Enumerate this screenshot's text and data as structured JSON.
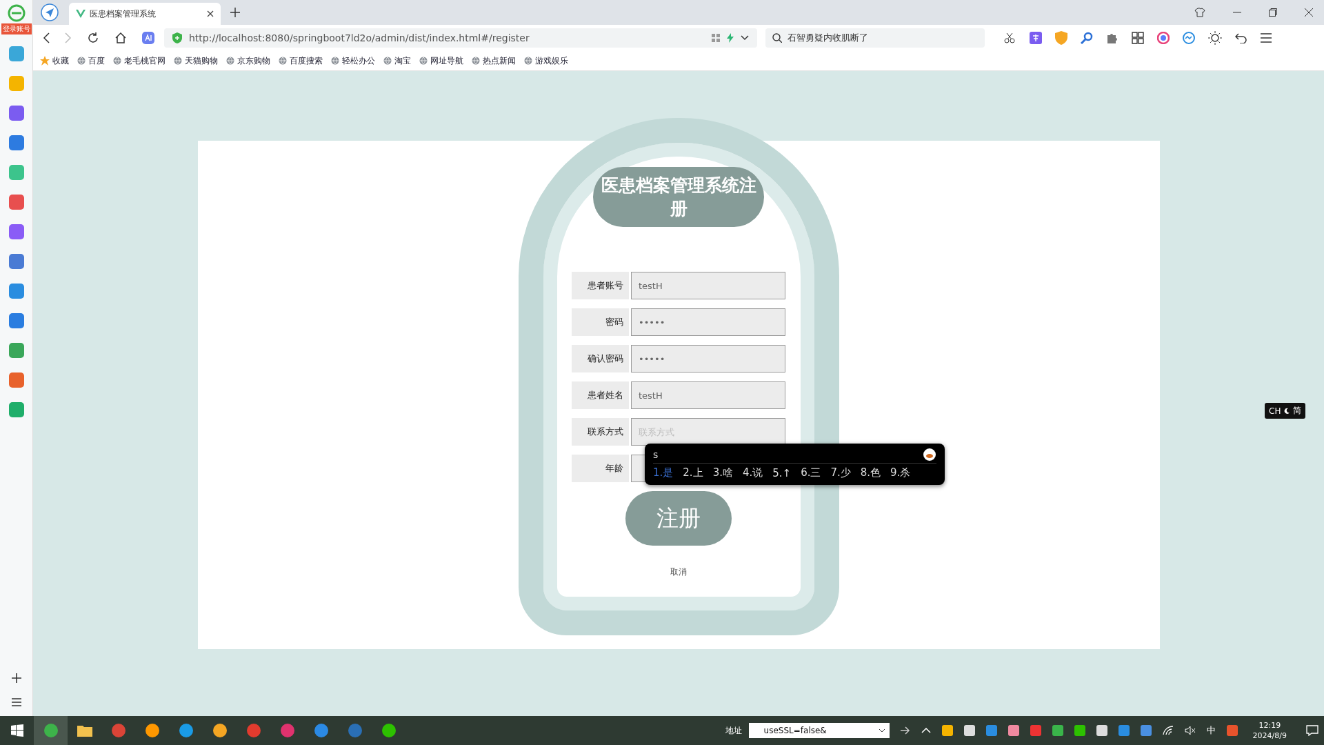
{
  "sidebar": {
    "badge": "登录账号"
  },
  "browser": {
    "tab_title": "医患档案管理系统",
    "url": "http://localhost:8080/springboot7ld2o/admin/dist/index.html#/register",
    "search": "石智勇疑内收肌断了",
    "bookmarks": [
      {
        "label": "收藏"
      },
      {
        "label": "百度"
      },
      {
        "label": "老毛桃官网"
      },
      {
        "label": "天猫购物"
      },
      {
        "label": "京东购物"
      },
      {
        "label": "百度搜索"
      },
      {
        "label": "轻松办公"
      },
      {
        "label": "淘宝"
      },
      {
        "label": "网址导航"
      },
      {
        "label": "热点新闻"
      },
      {
        "label": "游戏娱乐"
      }
    ]
  },
  "form": {
    "title": "医患档案管理系统注册",
    "fields": [
      {
        "label": "患者账号",
        "value": "testH"
      },
      {
        "label": "密码",
        "value": "•••••"
      },
      {
        "label": "确认密码",
        "value": "•••••"
      },
      {
        "label": "患者姓名",
        "value": "testH"
      },
      {
        "label": "联系方式",
        "placeholder": "联系方式"
      },
      {
        "label": "年龄"
      }
    ],
    "submit": "注册",
    "cancel": "取消"
  },
  "ime": {
    "input": "s",
    "candidates": [
      {
        "label": "1.是",
        "selected": true
      },
      {
        "label": "2.上",
        "selected": false
      },
      {
        "label": "3.啥",
        "selected": false
      },
      {
        "label": "4.说",
        "selected": false
      },
      {
        "label": "5.↑",
        "selected": false
      },
      {
        "label": "6.三",
        "selected": false
      },
      {
        "label": "7.少",
        "selected": false
      },
      {
        "label": "8.色",
        "selected": false
      },
      {
        "label": "9.杀",
        "selected": false
      }
    ]
  },
  "language_bar": {
    "left": "CH",
    "right": "简"
  },
  "taskbar": {
    "apps": [
      {
        "kind": "start",
        "selected": false
      },
      {
        "kind": "browser",
        "selected": true
      },
      {
        "kind": "folder",
        "selected": false
      },
      {
        "kind": "chrome",
        "selected": false
      },
      {
        "kind": "sublime",
        "selected": false
      },
      {
        "kind": "edge",
        "selected": false
      },
      {
        "kind": "navicat",
        "selected": false
      },
      {
        "kind": "wps",
        "selected": false
      },
      {
        "kind": "idea",
        "selected": false
      },
      {
        "kind": "todo",
        "selected": false
      },
      {
        "kind": "vmware",
        "selected": false
      },
      {
        "kind": "chat",
        "selected": false
      }
    ],
    "address_label": "地址",
    "address_value": "useSSL=false&",
    "ime_mode": "中",
    "time": "12:19",
    "date": "2024/8/9"
  }
}
